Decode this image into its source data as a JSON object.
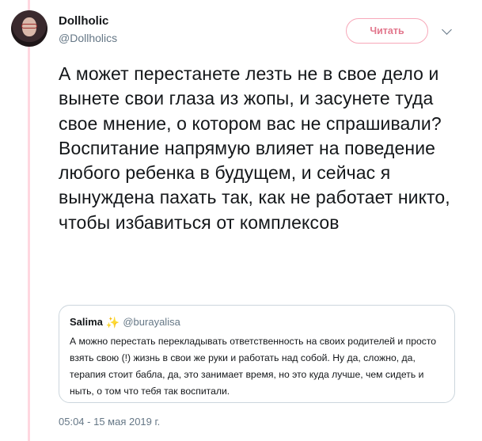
{
  "author": {
    "name": "Dollholic",
    "handle": "@Dollholics"
  },
  "follow_button": {
    "label": "Читать"
  },
  "tweet": {
    "text": "А может перестанете лезть не в свое дело и вынете свои глаза из жопы, и засунете туда свое мнение, о котором вас не спрашивали? Воспитание напрямую влияет на поведение любого ребенка в будущем, и сейчас я вынуждена пахать так, как не работает никто, чтобы избавиться от комплексов",
    "timestamp": "05:04 - 15 мая 2019 г."
  },
  "quoted_tweet": {
    "name": "Salima",
    "emoji": "✨",
    "handle": "@burayalisa",
    "text": "А можно перестать перекладывать ответственность на своих родителей и просто взять свою (!) жизнь в свои же руки и работать над собой. Ну да, сложно, да, терапия стоит бабла, да, это занимает время, но это куда лучше, чем сидеть и ныть, о том что тебя так воспитали."
  },
  "colors": {
    "accent": "#e2768c",
    "thread_line": "#ffd7e0",
    "muted": "#657786"
  }
}
